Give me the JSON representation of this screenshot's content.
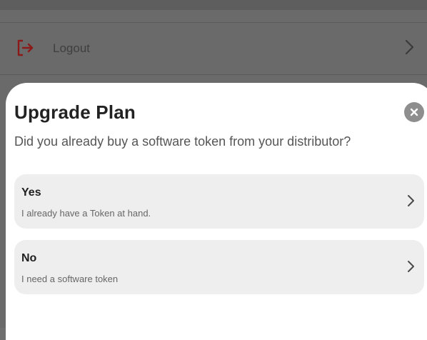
{
  "background": {
    "logout_label": "Logout",
    "logout_icon": "logout-icon",
    "accent_color": "#8b1a1a"
  },
  "sheet": {
    "title": "Upgrade Plan",
    "question": "Did you already buy a software token from your distributor?",
    "close_icon": "close-icon",
    "options": [
      {
        "title": "Yes",
        "subtitle": "I already have a Token at hand."
      },
      {
        "title": "No",
        "subtitle": "I need a software token"
      }
    ]
  }
}
